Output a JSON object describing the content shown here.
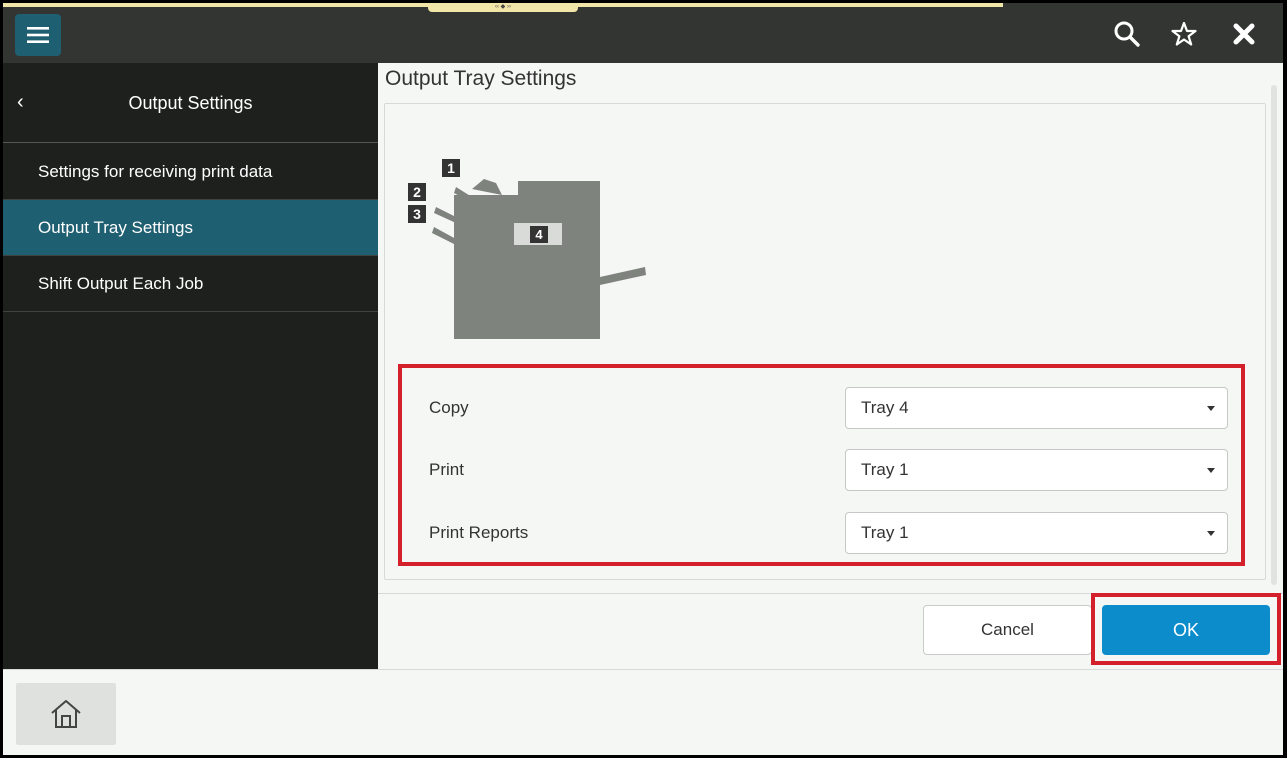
{
  "topbar": {
    "menu_icon": "hamburger-menu-icon",
    "handle_text": "‹‹ ◆ ››",
    "search_icon": "search-icon",
    "favorite_icon": "star-icon",
    "close_icon": "close-icon"
  },
  "sidebar": {
    "title": "Output Settings",
    "back_glyph": "‹",
    "items": [
      {
        "label": "Settings for receiving print data"
      },
      {
        "label": "Output Tray Settings"
      },
      {
        "label": "Shift Output Each Job"
      }
    ]
  },
  "main": {
    "title": "Output Tray Settings",
    "diagram": {
      "tray_labels": [
        "1",
        "2",
        "3",
        "4"
      ],
      "color": "#7e837d"
    },
    "settings": [
      {
        "label": "Copy",
        "value": "Tray 4"
      },
      {
        "label": "Print",
        "value": "Tray 1"
      },
      {
        "label": "Print Reports",
        "value": "Tray 1"
      }
    ]
  },
  "actions": {
    "cancel_label": "Cancel",
    "ok_label": "OK"
  },
  "bottombar": {
    "home_icon": "home-icon"
  },
  "colors": {
    "accent": "#1f5f72",
    "ok_blue": "#0d8ccc",
    "highlight_red": "#d4202a"
  }
}
